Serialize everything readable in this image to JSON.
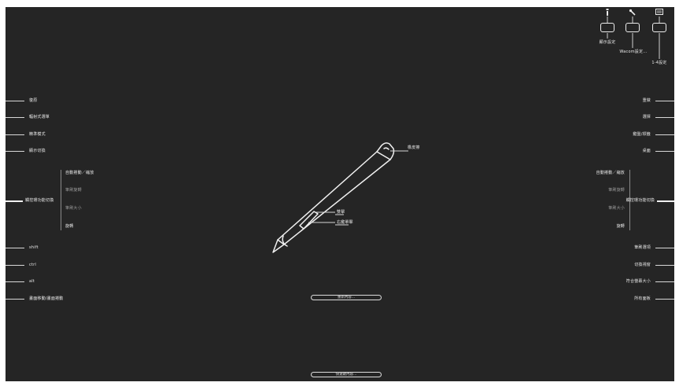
{
  "express_keys": {
    "display_settings": "顯示設定",
    "wacom_settings": "Wacom設定...",
    "tablet_settings": "1-4設定"
  },
  "left_side": {
    "items_top": [
      "復原",
      "輻射式選單",
      "精準模式",
      "顯示切換"
    ],
    "touch_ring_options": [
      "自動捲動／縮放",
      "筆刷旋轉",
      "筆刷大小",
      "旋轉"
    ],
    "touch_ring_toggle": "觸控環功能切換",
    "items_bottom": [
      "shift",
      "ctrl",
      "alt",
      "畫面移動/畫面捲動"
    ]
  },
  "right_side": {
    "items_top": [
      "重做",
      "選擇",
      "鍵盤/標籤",
      "桌面"
    ],
    "touch_ring_options": [
      "自動捲動／縮放",
      "筆刷旋轉",
      "筆刷大小",
      "旋轉"
    ],
    "touch_ring_toggle": "觸控環功能切換",
    "items_bottom": [
      "筆刷選項",
      "切換視窗",
      "符合螢幕大小",
      "所有面板"
    ]
  },
  "pen": {
    "eraser": "橡皮擦",
    "upper_button": "雙擊",
    "lower_button": "右鍵單擊"
  },
  "buttons": {
    "settings": "重新內容...",
    "toggle": "快速鍵內容..."
  },
  "colors": {
    "background": "#252525",
    "text": "#e8e8e8",
    "line": "#d8d8d8"
  }
}
